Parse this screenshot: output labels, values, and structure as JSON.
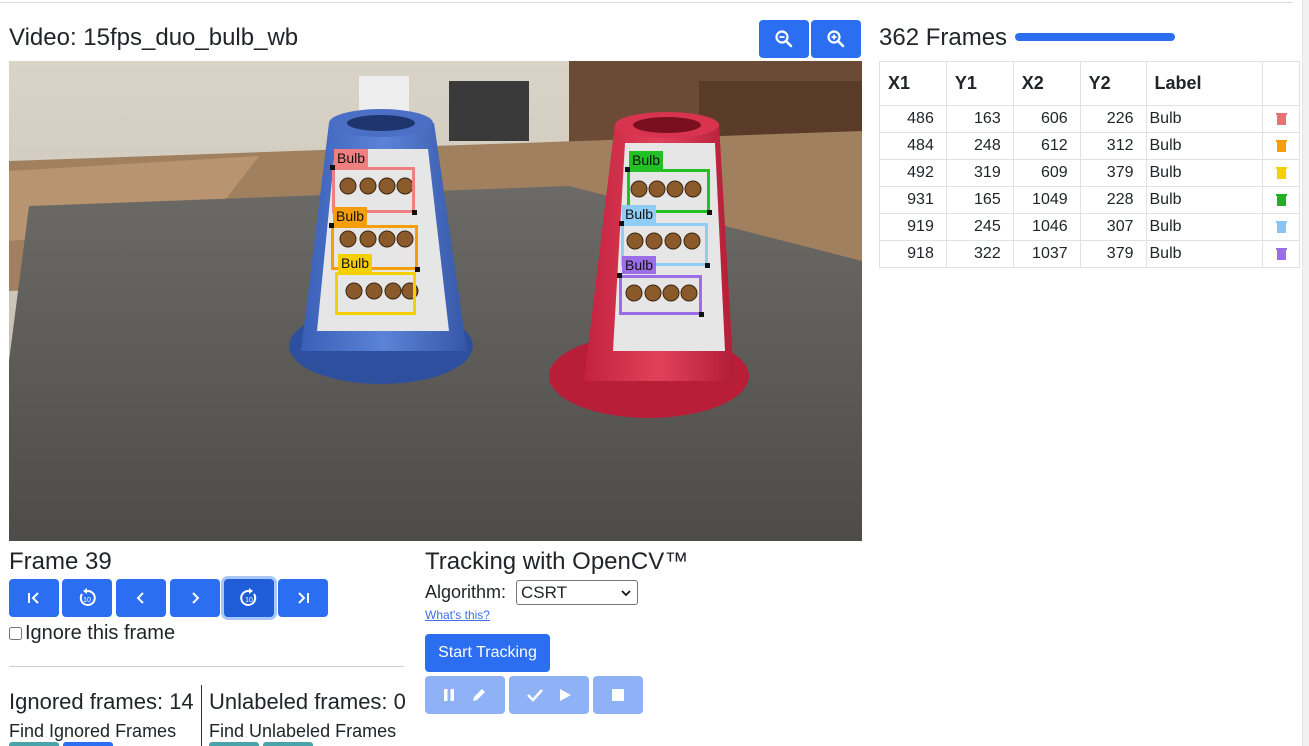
{
  "video": {
    "title": "Video: 15fps_duo_bulb_wb"
  },
  "zoom": {
    "zoom_out_icon": "zoom-out-icon",
    "zoom_in_icon": "zoom-in-icon"
  },
  "frames": {
    "count_label": "362 Frames",
    "progress": 1.0
  },
  "table": {
    "headers": [
      "X1",
      "Y1",
      "X2",
      "Y2",
      "Label",
      ""
    ],
    "rows": [
      {
        "x1": "486",
        "y1": "163",
        "x2": "606",
        "y2": "226",
        "label": "Bulb",
        "color": "#e57373"
      },
      {
        "x1": "484",
        "y1": "248",
        "x2": "612",
        "y2": "312",
        "label": "Bulb",
        "color": "#f59e0b"
      },
      {
        "x1": "492",
        "y1": "319",
        "x2": "609",
        "y2": "379",
        "label": "Bulb",
        "color": "#f5d000"
      },
      {
        "x1": "931",
        "y1": "165",
        "x2": "1049",
        "y2": "228",
        "label": "Bulb",
        "color": "#22b022"
      },
      {
        "x1": "919",
        "y1": "245",
        "x2": "1046",
        "y2": "307",
        "label": "Bulb",
        "color": "#86c5f5"
      },
      {
        "x1": "918",
        "y1": "322",
        "x2": "1037",
        "y2": "379",
        "label": "Bulb",
        "color": "#9b6ee8"
      }
    ]
  },
  "overlay_labels": [
    "Bulb",
    "Bulb",
    "Bulb",
    "Bulb",
    "Bulb",
    "Bulb"
  ],
  "frame": {
    "title": "Frame 39",
    "ignore_label": "Ignore this frame",
    "ignore_checked": false
  },
  "nav_icons": [
    "first-frame-icon",
    "back-10-icon",
    "previous-frame-icon",
    "next-frame-icon",
    "forward-10-icon",
    "last-frame-icon"
  ],
  "stats": {
    "ignored": "Ignored frames: 14",
    "unlabeled": "Unlabeled frames: 0",
    "find_ignored": "Find Ignored Frames",
    "find_unlabeled": "Find Unlabeled Frames"
  },
  "tracking": {
    "title": "Tracking with OpenCV™",
    "algorithm_label": "Algorithm:",
    "algorithm_value": "CSRT",
    "whats_this": "What's this?",
    "start_button": "Start Tracking"
  },
  "colors": {
    "primary": "#2b6ef2",
    "primary_light": "#8fb2f6"
  }
}
